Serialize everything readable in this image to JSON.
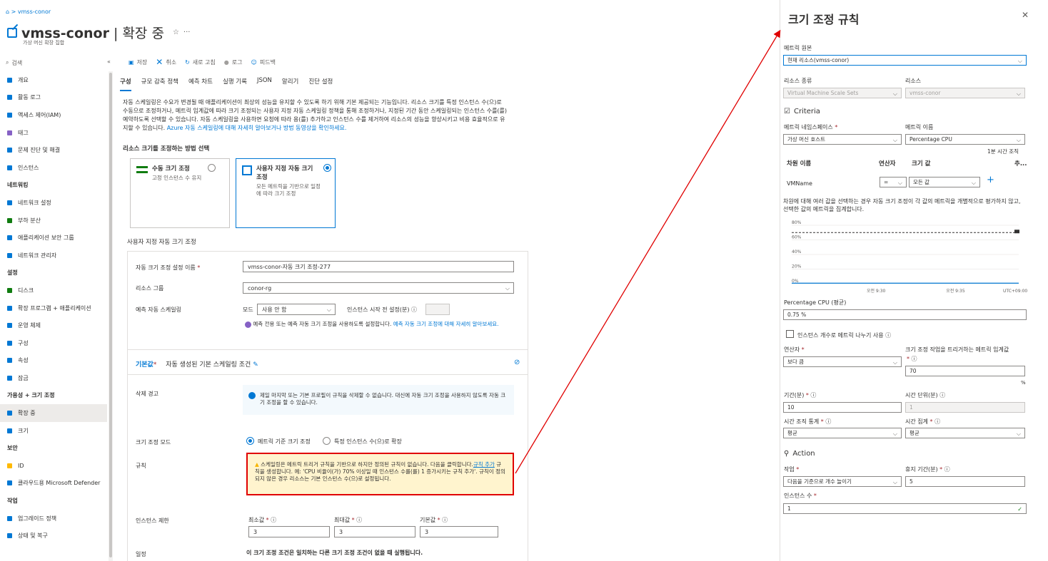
{
  "breadcrumb": {
    "home_icon": "home-icon",
    "sep": ">",
    "item": "vmss-conor"
  },
  "header": {
    "name": "vmss-conor",
    "sep": "|",
    "status": "확장 중",
    "subtitle": "가상 머신 확장 집합"
  },
  "search": {
    "placeholder": "검색"
  },
  "sidebar": {
    "items": [
      {
        "label": "개요",
        "color": "#0078d4"
      },
      {
        "label": "활동 로그",
        "color": "#0078d4"
      },
      {
        "label": "액세스 제어(IAM)",
        "color": "#0078d4"
      },
      {
        "label": "태그",
        "color": "#8661c5"
      },
      {
        "label": "문제 진단 및 해결",
        "color": "#0078d4"
      },
      {
        "label": "인스턴스",
        "color": "#0078d4"
      }
    ],
    "net_head": "네트워킹",
    "net_items": [
      {
        "label": "네트워크 설정",
        "color": "#0078d4"
      },
      {
        "label": "부하 분산",
        "color": "#107c10"
      },
      {
        "label": "애플리케이션 보안 그룹",
        "color": "#0078d4"
      },
      {
        "label": "네트워크 관리자",
        "color": "#0078d4"
      }
    ],
    "set_head": "설정",
    "set_items": [
      {
        "label": "디스크",
        "color": "#107c10"
      },
      {
        "label": "확장 프로그램 + 애플리케이션",
        "color": "#0078d4"
      },
      {
        "label": "운영 체제",
        "color": "#0078d4"
      },
      {
        "label": "구성",
        "color": "#0078d4"
      },
      {
        "label": "속성",
        "color": "#0078d4"
      },
      {
        "label": "잠금",
        "color": "#0078d4"
      }
    ],
    "avail_head": "가용성 + 크기 조정",
    "avail_items": [
      {
        "label": "확장 중",
        "color": "#0078d4",
        "active": true
      },
      {
        "label": "크기",
        "color": "#0078d4"
      }
    ],
    "sec_head": "보안",
    "sec_items": [
      {
        "label": "ID",
        "color": "#ffb900"
      },
      {
        "label": "클라우드용 Microsoft Defender",
        "color": "#0078d4"
      }
    ],
    "ops_head": "작업",
    "ops_items": [
      {
        "label": "업그레이드 정책",
        "color": "#0078d4"
      },
      {
        "label": "상태 및 복구",
        "color": "#0078d4"
      }
    ]
  },
  "toolbar": {
    "save": "저장",
    "cancel": "취소",
    "refresh": "새로 고침",
    "logs": "로그",
    "feedback": "피드백"
  },
  "tabs": [
    "구성",
    "규모 감축 정책",
    "예측 차트",
    "실행 기록",
    "JSON",
    "알리기",
    "진단 설정"
  ],
  "description": {
    "text": "자동 스케일링은 수요가 변경될 때 애플리케이션이 최상의 성능을 유지할 수 있도록 하기 위해 기본 제공되는 기능입니다. 리소스 크기를 특정 인스턴스 수(으)로 수동으로 조정하거나, 메트릭 임계값에 따라 크기 조정되는 사용자 지정 자동 스케일링 정책을 통해 조정하거나, 지정된 기간 동안 스케일링되는 인스턴스 수를(를) 예약하도록 선택할 수 있습니다. 자동 스케일링을 사용하면 요청에 따라 용(를) 추가하고 인스턴스 수를 제거하여 리소스의 성능을 향상시키고 비용 효율적으로 유지할 수 있습니다.",
    "link": "Azure 자동 스케일링에 대해 자세히 알아보거나 방법 동영상을 확인하세요."
  },
  "method": {
    "heading": "리소스 크기를 조정하는 방법 선택",
    "manual_title": "수동 크기 조정",
    "manual_sub": "고정 인스턴스 수 유지",
    "custom_title": "사용자 지정 자동 크기 조정",
    "custom_sub": "모든 메트릭을 기반으로 일정에 따라 크기 조정"
  },
  "custom": {
    "section": "사용자 지정 자동 크기 조정",
    "setting_name_label": "자동 크기 조정 설정 이름",
    "setting_name": "vmss-conor-자동 크기 조정-277",
    "rg_label": "리소스 그룹",
    "rg": "conor-rg",
    "predictive_label": "예측 자동 스케일링",
    "mode_label": "모드",
    "mode": "사용 안 함",
    "warmup_label": "인스턴스 시작 전 설정(분)",
    "predictive_note": "예측 전용 또는 예측 자동 크기 조정을 사용하도록 설정합니다.",
    "predictive_link": "예측 자동 크기 조정에 대해 자세히 알아보세요.",
    "default_label": "기본값",
    "default_title": "자동 생성된 기본 스케일링 조건",
    "delete_warn_label": "삭제 경고",
    "delete_warn": "제일 마지막 또는 기본 프로필이 규칙을 삭제할 수 없습니다. 대신에 자동 크기 조정을 사용하지 않도록 자동 크기 조정을 할 수 있습니다.",
    "scale_mode_label": "크기 조정 모드",
    "scale_mode_metric": "메트릭 기준 크기 조정",
    "scale_mode_count": "특정 인스턴스 수(으)로 확장",
    "rules_label": "규칙",
    "rules_warn_a": "스케일링은 메트릭 트리거 규칙을 기반으로 하지만 정의된 규칙이 없습니다. 다음을 클릭합니다.",
    "rules_warn_link": "규칙 추가",
    "rules_warn_b": "규칙을 생성합니다. 예: 'CPU 비율이(가) 70% 이상일 때 인스턴스 수를(를) 1 증가시키는 규칙 추가'. 규칙이 정의되지 않은 경우 리소스는 기본 인스턴스 수(으)로 설정됩니다.",
    "limits_label": "인스턴스 제한",
    "min_label": "최소값",
    "max_label": "최대값",
    "def_label": "기본값",
    "min": "3",
    "max": "3",
    "def": "3",
    "schedule_label": "일정",
    "schedule": "이 크기 조정 조건은 일치하는 다른 크기 조정 조건이 없을 때 실행됩니다."
  },
  "right": {
    "title": "크기 조정 규칙",
    "metric_source_label": "메트릭 원본",
    "metric_source": "현재 리소스(vmss-conor)",
    "resource_type_label": "리소스 종류",
    "resource_type": "Virtual Machine Scale Sets",
    "resource_label": "리소스",
    "resource": "vmss-conor",
    "criteria": "Criteria",
    "namespace_label": "메트릭 네임스페이스",
    "namespace": "가상 머신 호스트",
    "metric_name_label": "메트릭 이름",
    "metric_name": "Percentage CPU",
    "time_grain": "1분 시간 조직",
    "dim_name": "차원 이름",
    "operator_col": "연산자",
    "dim_values": "크기 값",
    "add_col": "추...",
    "dim_row_name": "VMName",
    "dim_row_op": "=",
    "dim_row_val": "모든 값",
    "dim_note": "차원에 대해 여러 값을 선택하는 경우 자동 크기 조정이 각 값의 메트릭을 개별적으로 평가하지 않고, 선택한 값의 메트릭을 집계합니다.",
    "chart_ticks": [
      "80%",
      "60%",
      "40%",
      "20%",
      "0%"
    ],
    "chart_x": [
      "오전 9:30",
      "오전 9:35",
      "UTC+09:00"
    ],
    "metric_val_label": "Percentage CPU (평균)",
    "metric_val": "0.75 %",
    "divide_label": "인스턴스 개수로 메트릭 나누기 사용",
    "op_label": "연산자",
    "op": "보다 큼",
    "threshold_label": "크기 조정 작업을 트리거하는 메트릭 임계값",
    "threshold": "70",
    "pct": "%",
    "duration_label": "기간(분)",
    "duration": "10",
    "grain_label": "시간 단위(분)",
    "grain": "1",
    "grain_stat_label": "시간 조직 통계",
    "grain_stat": "평균",
    "agg_label": "시간 집계",
    "agg": "평균",
    "action": "Action",
    "op2_label": "작업",
    "op2": "다음을 기준으로 개수 늘이기",
    "cool_label": "휴지 기간(분)",
    "cool": "5",
    "count_label": "인스턴스 수",
    "count": "1"
  },
  "chart_data": {
    "type": "line",
    "x": [
      "오전 9:30",
      "오전 9:35"
    ],
    "series": [
      {
        "values": [
          0.75,
          0.75
        ]
      }
    ],
    "ylim": [
      0,
      80
    ]
  }
}
